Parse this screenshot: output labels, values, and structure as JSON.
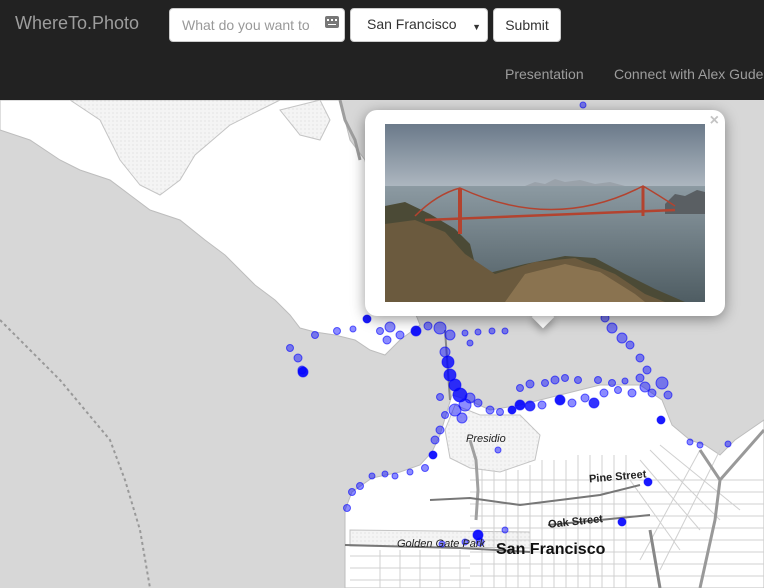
{
  "navbar": {
    "brand": "WhereTo.Photo",
    "search_placeholder": "What do you want to see?",
    "city_selected": "San Francisco",
    "submit_label": "Submit",
    "links": [
      "Presentation",
      "Connect with Alex Gude"
    ]
  },
  "map": {
    "labels": {
      "presidio": "Presidio",
      "pine": "Pine Street",
      "oak": "Oak Street",
      "golden_gate_park": "Golden Gate Park",
      "city": "San Francisco"
    },
    "marker_color": "#0000ff",
    "water_color": "#d7d7d7",
    "land_color": "#ffffff"
  },
  "popup": {
    "close_symbol": "×",
    "photo_subject": "Golden Gate Bridge from Marin Headlands"
  }
}
